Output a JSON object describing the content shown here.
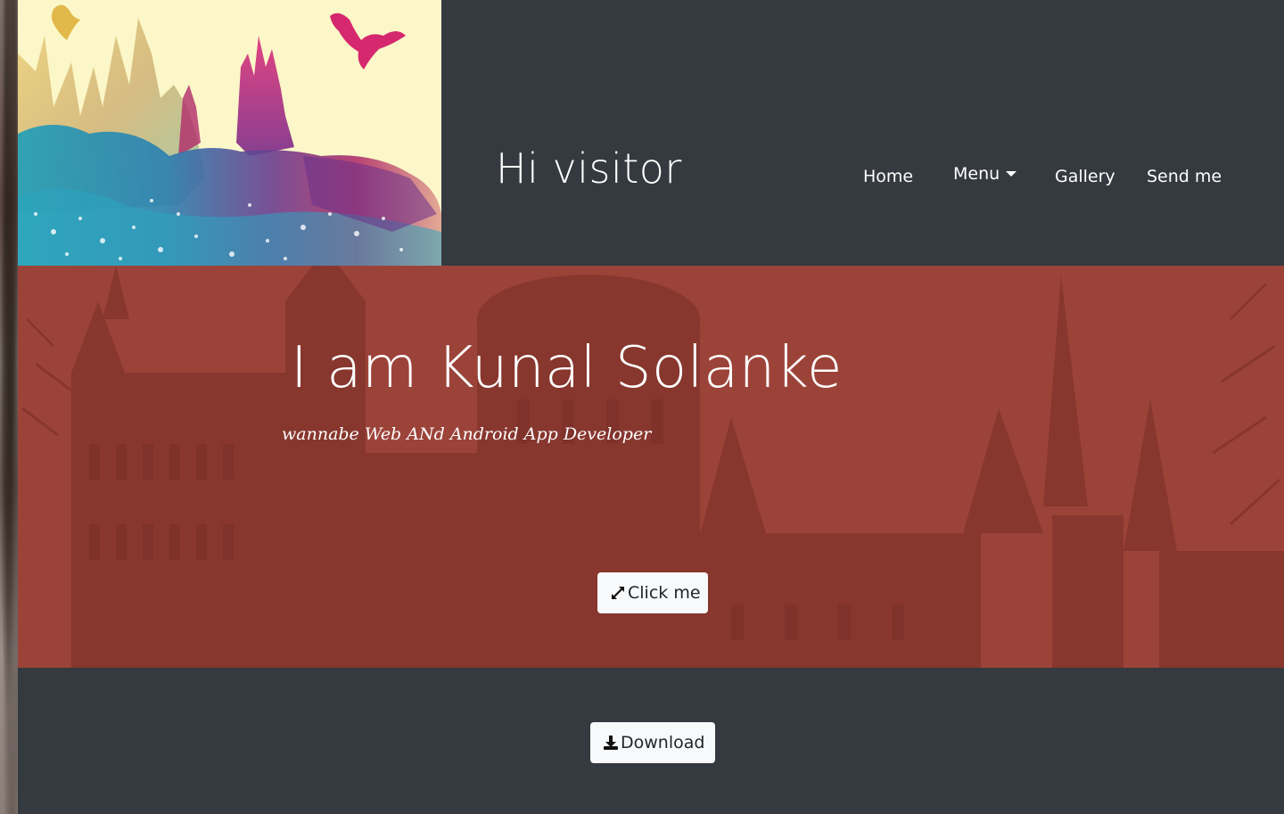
{
  "header": {
    "title": "Hi visitor",
    "logo": "castle-watercolor-logo"
  },
  "nav": {
    "items": [
      {
        "label": "Home"
      },
      {
        "label": "Menu"
      },
      {
        "label": "Gallery"
      },
      {
        "label": "Send me"
      }
    ]
  },
  "hero": {
    "heading": "I am Kunal Solanke",
    "subheading": "wannabe Web ANd Android App Developer",
    "button_label": "Click me",
    "button_icon": "expand-arrows-icon"
  },
  "footer": {
    "button_label": "Download",
    "button_icon": "download-icon"
  },
  "colors": {
    "header_bg": "#343a40",
    "hero_bg": "#9b4238",
    "button_bg": "#f8f9fa",
    "text": "#ffffff"
  }
}
